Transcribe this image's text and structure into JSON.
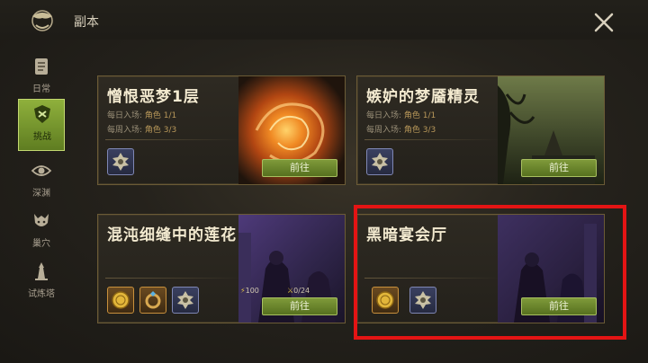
{
  "header": {
    "title": "副本"
  },
  "sidebar": {
    "items": [
      {
        "label": "日常",
        "icon": "scroll-icon"
      },
      {
        "label": "挑战",
        "icon": "shield-challenge-icon"
      },
      {
        "label": "深渊",
        "icon": "eye-icon"
      },
      {
        "label": "巢穴",
        "icon": "beast-icon"
      },
      {
        "label": "试炼塔",
        "icon": "tower-icon"
      }
    ]
  },
  "dungeons": [
    {
      "title": "憎恨恶梦1层",
      "daily_label": "每日入场:",
      "daily_value": "角色 1/1",
      "weekly_label": "每周入场:",
      "weekly_value": "角色 3/3",
      "button": "前往"
    },
    {
      "title": "嫉妒的梦靥精灵",
      "daily_label": "每日入场:",
      "daily_value": "角色 1/1",
      "weekly_label": "每周入场:",
      "weekly_value": "角色 3/3",
      "button": "前往"
    },
    {
      "title": "混沌细缝中的莲花",
      "stat_power": "100",
      "stat_count": "0/24",
      "button": "前往"
    },
    {
      "title": "黑暗宴会厅",
      "button": "前往"
    }
  ],
  "colors": {
    "accent_green": "#6d8a2c",
    "highlight_red": "#e41414",
    "card_border": "#6b5b36"
  }
}
